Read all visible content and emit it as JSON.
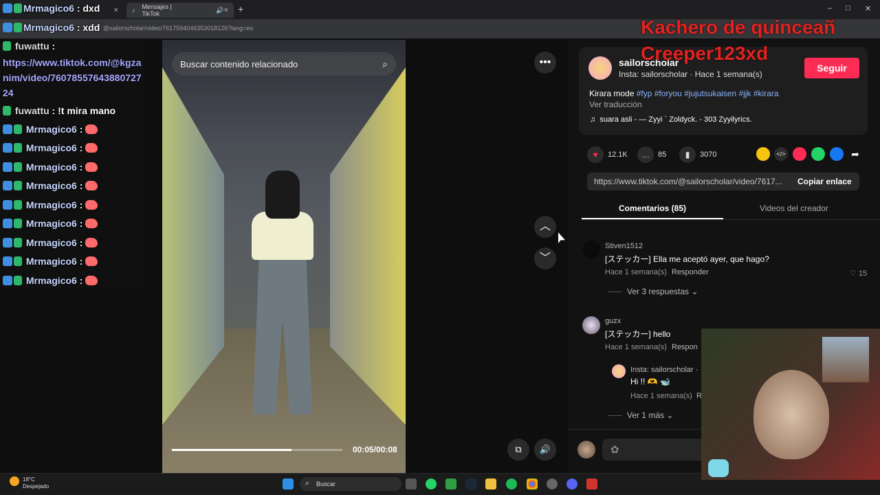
{
  "browser": {
    "tabs": [
      {
        "label": "",
        "icon": "tiktok-icon"
      },
      {
        "label": "Mensajes | TikTok",
        "icon": "tiktok-icon"
      }
    ],
    "url": "@sailorscholar/video/7617594046353018126?lang=es"
  },
  "chat": {
    "messages": [
      {
        "user": "Mrmagico6",
        "text": ": dxd"
      },
      {
        "user": "Mrmagico6",
        "text": ": xdd"
      },
      {
        "user": "fuwattu",
        "text": ":"
      },
      {
        "user": "fuwattu",
        "text": ": !t mira mano"
      },
      {
        "user": "Mrmagico6",
        "text": ":"
      },
      {
        "user": "Mrmagico6",
        "text": ":"
      },
      {
        "user": "Mrmagico6",
        "text": ":"
      },
      {
        "user": "Mrmagico6",
        "text": ":"
      },
      {
        "user": "Mrmagico6",
        "text": ":"
      },
      {
        "user": "Mrmagico6",
        "text": ":"
      },
      {
        "user": "Mrmagico6",
        "text": ":"
      },
      {
        "user": "Mrmagico6",
        "text": ":"
      },
      {
        "user": "Mrmagico6",
        "text": ":"
      }
    ],
    "link": "https://www.tiktok.com/@kgzanim/video/7607855764388072724"
  },
  "overlay": {
    "line1": "Kachero de quinceañ",
    "line2": "Creeper123xd"
  },
  "video": {
    "search_placeholder": "Buscar contenido relacionado",
    "time": "00:05/00:08",
    "progress": 0.7
  },
  "post": {
    "username": "sailorscholar",
    "subtitle": "Insta: sailorscholar · Hace 1 semana(s)",
    "follow_label": "Seguir",
    "caption": "Kirara mode",
    "hashtags": "#fyp #foryou #jujutsukaisen #jjk #kirara",
    "translate": "Ver traducción",
    "song": "suara asli - — Zyyi ` Zoldyck. - 303 Zyyilyrics.",
    "likes": "12.1K",
    "comments": "85",
    "saves": "3070",
    "share_url": "https://www.tiktok.com/@sailorscholar/video/7617...",
    "copy_label": "Copiar enlace",
    "tab_comments": "Comentarios (85)",
    "tab_videos": "Videos del creador",
    "brand_color": "#fe2c55"
  },
  "comments": [
    {
      "user": "Stiven1512",
      "text": "[ステッカー] Ella me aceptó ayer, que hago?",
      "meta": "Hace 1 semana(s)",
      "reply": "Responder",
      "likes": "15",
      "more": "Ver 3 respuestas"
    },
    {
      "user": "guzx",
      "text": "[ステッカー] hello",
      "meta": "Hace 1 semana(s)",
      "reply": "Respon"
    },
    {
      "user": "Insta: sailorscholar ·",
      "text": "Hi !! 🫶 🐋",
      "meta": "Hace 1 semana(s)",
      "reply": "R",
      "more": "Ver 1 más"
    }
  ],
  "taskbar": {
    "temp": "18°C",
    "weather": "Despejado",
    "search": "Buscar"
  }
}
